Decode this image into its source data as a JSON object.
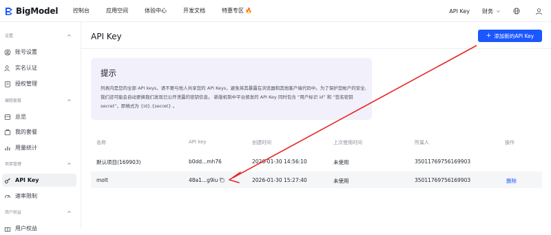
{
  "brand": {
    "name": "BigModel"
  },
  "top_nav": [
    {
      "label": "控制台"
    },
    {
      "label": "应用空间"
    },
    {
      "label": "体验中心"
    },
    {
      "label": "开发文档"
    },
    {
      "label": "特惠专区"
    }
  ],
  "top_right": {
    "api_key": "API Key",
    "finance": "财务"
  },
  "sidebar": {
    "sections": [
      {
        "label": "设置",
        "items": [
          "账号设置",
          "实名认证",
          "授权管理"
        ]
      },
      {
        "label": "编程套餐",
        "items": [
          "总览",
          "我的套餐",
          "用量统计"
        ]
      },
      {
        "label": "项目管理",
        "items": [
          "API Key",
          "速率限制"
        ]
      },
      {
        "label": "用户权益",
        "items": [
          "用户权益"
        ]
      }
    ],
    "active": "API Key"
  },
  "page": {
    "title": "API Key",
    "add_button": "添加新的API Key"
  },
  "tip": {
    "title": "提示",
    "text": "列表内是您的全部 API keys，请不要与他人共享您的 API Keys，避免将其暴露在浏览器和其他客户端代码中。为了保护您帐户的安全,我们还可能会自动更换我们发现已公开泄露的密钥信息。 新版机制中平台颁发的 API Key 同时包含 “用户标识 id” 和 “签名密钥 secret”，即格式为 {id}.{secret} 。"
  },
  "table": {
    "headers": [
      "名称",
      "API key",
      "创建时间",
      "上次使用时间",
      "所属人",
      "操作"
    ],
    "rows": [
      {
        "name": "默认项目(169903)",
        "key": "b0dd...mh76",
        "created": "2026-01-30 14:56:10",
        "last_used": "未使用",
        "owner": "35011769756169903",
        "action": ""
      },
      {
        "name": "molt",
        "key": "48a1...g9iu",
        "created": "2026-01-30 15:27:40",
        "last_used": "未使用",
        "owner": "35011769756169903",
        "action": "删除"
      }
    ]
  },
  "colors": {
    "primary": "#1b57ff",
    "annotation": "#e8231f",
    "tip_bg": "#f1f0fb"
  }
}
